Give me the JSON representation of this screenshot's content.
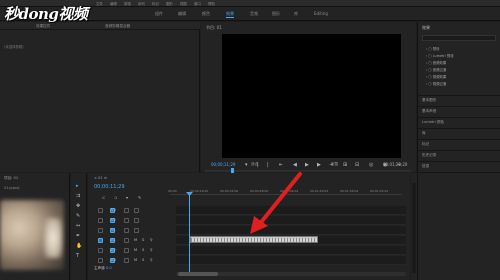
{
  "watermark": "秒dong视频",
  "menu": [
    "文件",
    "编辑",
    "剪辑",
    "序列",
    "标记",
    "图形",
    "视图",
    "窗口",
    "帮助"
  ],
  "workspaces": [
    "组件",
    "编辑",
    "颜色",
    "效果",
    "音频",
    "图形",
    "库",
    "Editing"
  ],
  "active_workspace": "效果",
  "source_panel": {
    "tabs": [
      "效果控件",
      "音频剪辑混合器"
    ],
    "empty_text": "(未选择剪辑)"
  },
  "program": {
    "title": "节目: 01",
    "timecode": "00;00;11;29",
    "fit": "适合",
    "full": "完整",
    "duration": "00;01;20;20"
  },
  "transport_icons": [
    "marker",
    "in",
    "out",
    "step-back",
    "play",
    "step-forward",
    "insert",
    "overwrite",
    "export",
    "export-frame",
    "vr"
  ],
  "right_panel": {
    "title": "效果",
    "tree": [
      "预设",
      "Lumetri 预设",
      "音频效果",
      "音频过渡",
      "视频效果",
      "视频过渡"
    ],
    "rows": [
      "基本图形",
      "基本声音",
      "Lumetri 颜色",
      "库",
      "标记",
      "历史记录",
      "信息"
    ]
  },
  "project": {
    "title": "项目: 01",
    "sub": "01.prproj"
  },
  "tools": [
    "selection-tool",
    "track-select-tool",
    "ripple-edit-tool",
    "razor-tool",
    "slip-tool",
    "pen-tool",
    "hand-tool",
    "type-tool"
  ],
  "timeline": {
    "tab": "× 01 ≡",
    "timecode": "00;00;11;29",
    "ruler": [
      "00;00",
      "00;00;16;00",
      "00;00;32;00",
      "00;00;48;00",
      "00;01;04;02",
      "00;01;20;02",
      "00;01;36;02",
      "00;01;52;02"
    ],
    "tracks": [
      "V3",
      "V2",
      "V1",
      "A1",
      "A2",
      "A3"
    ],
    "bottom": "主声道",
    "bottom_value": "0.0"
  }
}
